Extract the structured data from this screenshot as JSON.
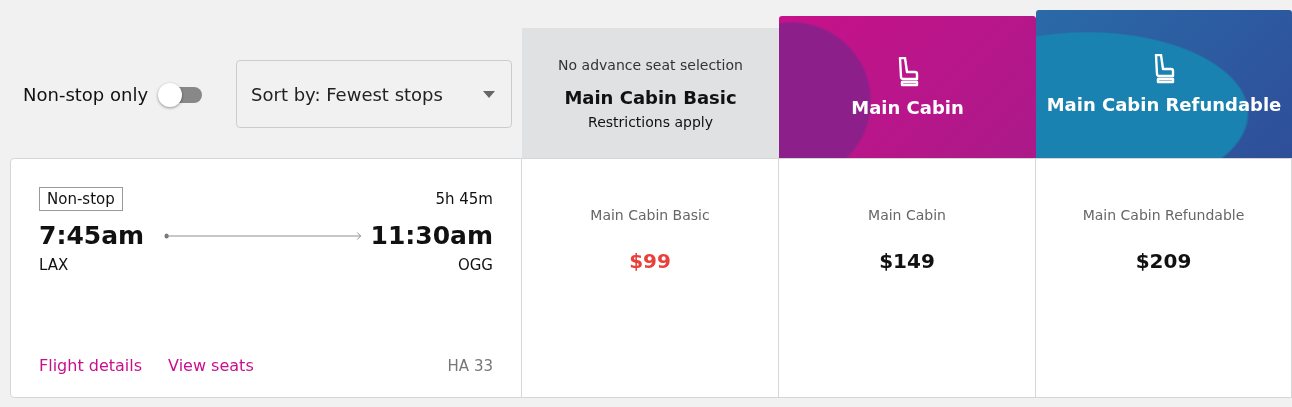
{
  "filters": {
    "nonstop_toggle": {
      "label": "Non-stop only",
      "on": false
    },
    "sort": {
      "value": "Sort by: Fewest stops"
    }
  },
  "fare_headers": [
    {
      "kind": "plain",
      "note": "No advance seat selection",
      "title": "Main Cabin Basic",
      "subtitle": "Restrictions apply"
    },
    {
      "kind": "magenta",
      "title": "Main Cabin"
    },
    {
      "kind": "blue",
      "title": "Main Cabin Refundable"
    }
  ],
  "flight": {
    "badge": "Non-stop",
    "duration": "5h 45m",
    "depart_time": "7:45am",
    "arrive_time": "11:30am",
    "origin": "LAX",
    "destination": "OGG",
    "links": [
      "Flight details",
      "View seats"
    ],
    "flight_number": "HA 33",
    "fares": [
      {
        "name": "Main Cabin Basic",
        "price": "$99",
        "highlight": true
      },
      {
        "name": "Main Cabin",
        "price": "$149",
        "highlight": false
      },
      {
        "name": "Main Cabin Refundable",
        "price": "$209",
        "highlight": false
      }
    ]
  }
}
